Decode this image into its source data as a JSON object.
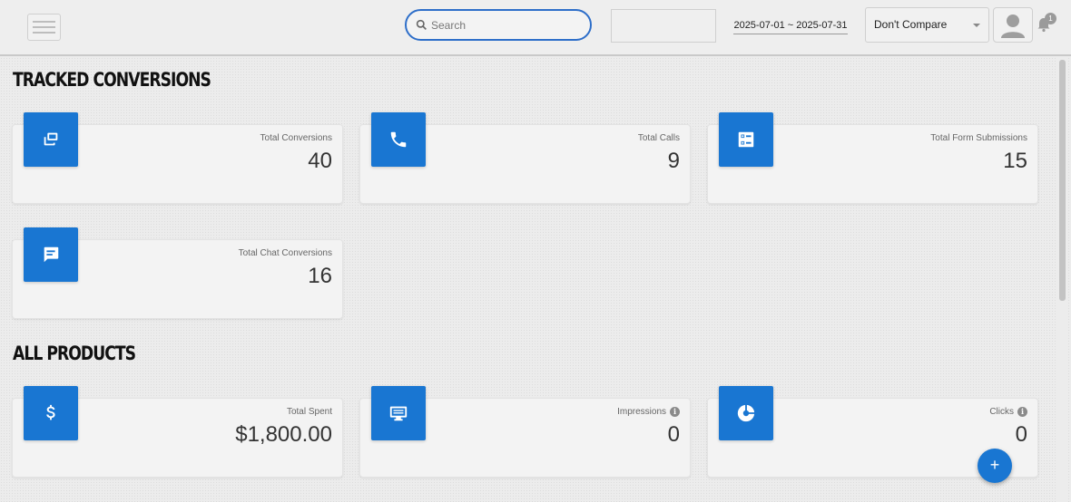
{
  "header": {
    "search_placeholder": "Search",
    "date_range": "2025-07-01 ~ 2025-07-31",
    "compare_value": "Don't Compare",
    "notification_count": "1"
  },
  "sections": {
    "tracked_conversions": "TRACKED CONVERSIONS",
    "all_products": "ALL PRODUCTS"
  },
  "tracked_cards": [
    {
      "label": "Total Conversions",
      "value": "40",
      "icon": "conversions-icon"
    },
    {
      "label": "Total Calls",
      "value": "9",
      "icon": "phone-icon"
    },
    {
      "label": "Total Form Submissions",
      "value": "15",
      "icon": "form-icon"
    },
    {
      "label": "Total Chat Conversions",
      "value": "16",
      "icon": "chat-icon"
    }
  ],
  "product_cards": [
    {
      "label": "Total Spent",
      "value": "$1,800.00",
      "icon": "dollar-icon"
    },
    {
      "label": "Impressions",
      "value": "0",
      "icon": "monitor-icon"
    },
    {
      "label": "Clicks",
      "value": "0",
      "icon": "pie-chart-icon"
    }
  ],
  "fab_label": "+",
  "info_glyph": "i",
  "colors": {
    "accent": "#1976d2",
    "search_border": "#2d6ec9"
  }
}
